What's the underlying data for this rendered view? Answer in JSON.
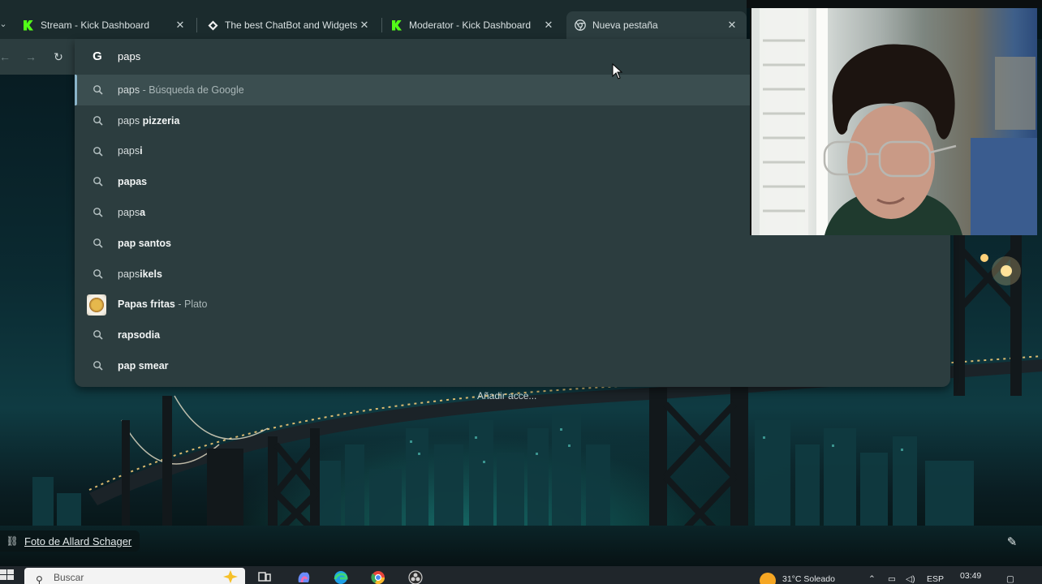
{
  "tabs": [
    {
      "title": "Stream - Kick Dashboard",
      "icon": "kick-logo-icon",
      "active": false
    },
    {
      "title": "The best ChatBot and Widgets",
      "icon": "botrix-icon",
      "active": false
    },
    {
      "title": "Moderator - Kick Dashboard",
      "icon": "kick-logo-icon",
      "active": false
    },
    {
      "title": "Nueva pestaña",
      "icon": "chrome-icon",
      "active": true
    }
  ],
  "omnibox": {
    "query": "paps",
    "suggestions": [
      {
        "prefix": "paps",
        "bold": "",
        "suffix": " - Búsqueda de Google",
        "icon": "search-icon",
        "selected": true
      },
      {
        "prefix": "paps ",
        "bold": "pizzeria",
        "suffix": "",
        "icon": "search-icon",
        "selected": false
      },
      {
        "prefix": "paps",
        "bold": "i",
        "suffix": "",
        "icon": "search-icon",
        "selected": false
      },
      {
        "prefix": "",
        "bold": "papas",
        "suffix": "",
        "icon": "search-icon",
        "selected": false
      },
      {
        "prefix": "paps",
        "bold": "a",
        "suffix": "",
        "icon": "search-icon",
        "selected": false
      },
      {
        "prefix": "",
        "bold": "pap santos",
        "suffix": "",
        "icon": "search-icon",
        "selected": false
      },
      {
        "prefix": "paps",
        "bold": "ikels",
        "suffix": "",
        "icon": "search-icon",
        "selected": false
      },
      {
        "prefix": "",
        "bold": "Papas fritas",
        "suffix": " - Plato",
        "icon": "food-thumbnail",
        "selected": false
      },
      {
        "prefix": "",
        "bold": "rapsodia",
        "suffix": "",
        "icon": "search-icon",
        "selected": false
      },
      {
        "prefix": "",
        "bold": "pap smear",
        "suffix": "",
        "icon": "search-icon",
        "selected": false
      }
    ]
  },
  "new_tab": {
    "add_shortcut": "Añadir acce...",
    "photo_credit": "Foto de Allard Schager"
  },
  "taskbar": {
    "search_placeholder": "Buscar",
    "weather": "31°C  Soleado",
    "language": "ESP",
    "time": "03:49"
  }
}
